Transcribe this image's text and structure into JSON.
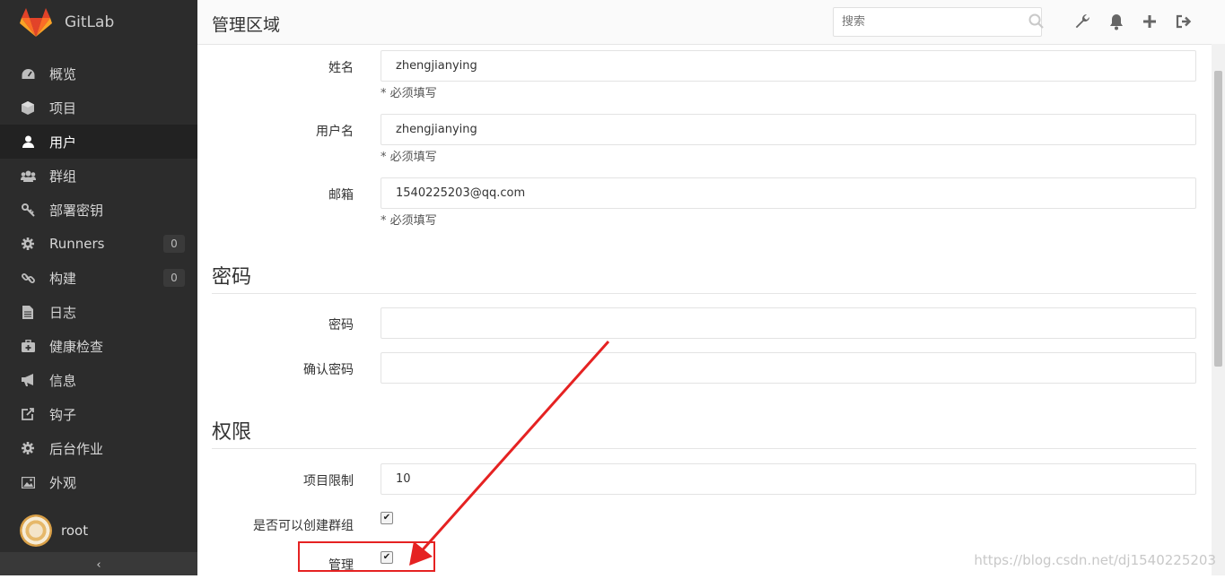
{
  "brand": {
    "title": "GitLab"
  },
  "sidebar": {
    "items": [
      {
        "label": "概览",
        "icon": "dashboard-icon",
        "active": false
      },
      {
        "label": "项目",
        "icon": "cube-icon",
        "active": false
      },
      {
        "label": "用户",
        "icon": "user-icon",
        "active": true
      },
      {
        "label": "群组",
        "icon": "users-icon",
        "active": false
      },
      {
        "label": "部署密钥",
        "icon": "key-icon",
        "active": false
      },
      {
        "label": "Runners",
        "icon": "cog-icon",
        "active": false,
        "badge": "0"
      },
      {
        "label": "构建",
        "icon": "link-icon",
        "active": false,
        "badge": "0"
      },
      {
        "label": "日志",
        "icon": "file-icon",
        "active": false
      },
      {
        "label": "健康检查",
        "icon": "medkit-icon",
        "active": false
      },
      {
        "label": "信息",
        "icon": "bullhorn-icon",
        "active": false
      },
      {
        "label": "钩子",
        "icon": "external-link-icon",
        "active": false
      },
      {
        "label": "后台作业",
        "icon": "cog-icon",
        "active": false
      },
      {
        "label": "外观",
        "icon": "image-icon",
        "active": false
      }
    ],
    "user": {
      "name": "root"
    },
    "collapse_symbol": "‹"
  },
  "header": {
    "title": "管理区域",
    "search_placeholder": "搜索"
  },
  "form": {
    "name": {
      "label": "姓名",
      "value": "zhengjianying",
      "hint": "* 必须填写"
    },
    "username": {
      "label": "用户名",
      "value": "zhengjianying",
      "hint": "* 必须填写"
    },
    "email": {
      "label": "邮箱",
      "value": "1540225203@qq.com",
      "hint": "* 必须填写"
    },
    "password_section": "密码",
    "password": {
      "label": "密码",
      "value": ""
    },
    "password_confirm": {
      "label": "确认密码",
      "value": ""
    },
    "access_section": "权限",
    "projects_limit": {
      "label": "项目限制",
      "value": "10"
    },
    "can_create_group": {
      "label": "是否可以创建群组",
      "checked": true
    },
    "admin": {
      "label": "管理",
      "checked": true
    }
  },
  "watermark": "https://blog.csdn.net/dj1540225203",
  "colors": {
    "sidebar": "#2c2c2c",
    "annotation": "#e52222",
    "gitlab_orange": "#fc6d26"
  }
}
